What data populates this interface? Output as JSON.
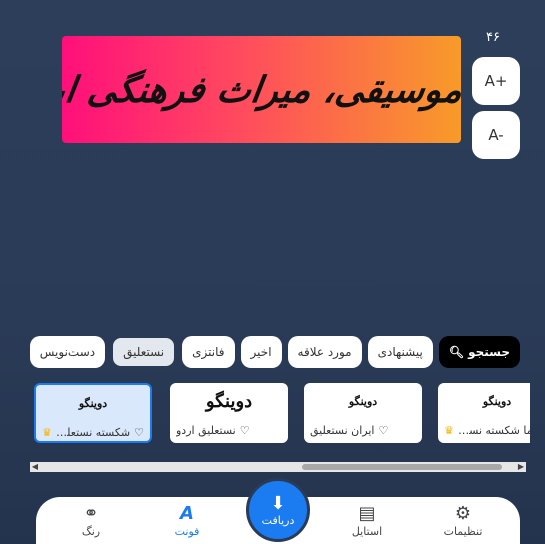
{
  "font_size_readout": "۴۶",
  "preview": {
    "text": "هنر موسیقی، میراث فرهنگی ایران",
    "gradient": [
      "#ff0f7b",
      "#f89b29"
    ]
  },
  "zoom": {
    "increase_label": "A+",
    "decrease_label": "A-"
  },
  "filters": [
    {
      "label": "جستجو",
      "kind": "search"
    },
    {
      "label": "پیشنهادی"
    },
    {
      "label": "مورد علاقه"
    },
    {
      "label": "اخیر"
    },
    {
      "label": "فانتزی"
    },
    {
      "label": "نستعلیق",
      "selected": true
    },
    {
      "label": "دست‌نویس"
    }
  ],
  "fonts": [
    {
      "preview": "دوینگو",
      "name": "یما شکسته نستعلیق",
      "premium": true
    },
    {
      "preview": "دوینگو",
      "name": "ایران نستعلیق",
      "premium": false
    },
    {
      "preview": "دوینگو",
      "name": "نستعلیق اردو",
      "premium": false
    },
    {
      "preview": "دوینگو",
      "name": "شکسته نستعلیق",
      "premium": true,
      "selected": true
    }
  ],
  "download": {
    "label": "دریافت"
  },
  "nav": {
    "settings": "تنظیمات",
    "style": "استایل",
    "font": "فونت",
    "color": "رنگ"
  },
  "colors": {
    "accent": "#1a7cf0",
    "background": "#2a3b57",
    "premium": "#f5b400"
  }
}
